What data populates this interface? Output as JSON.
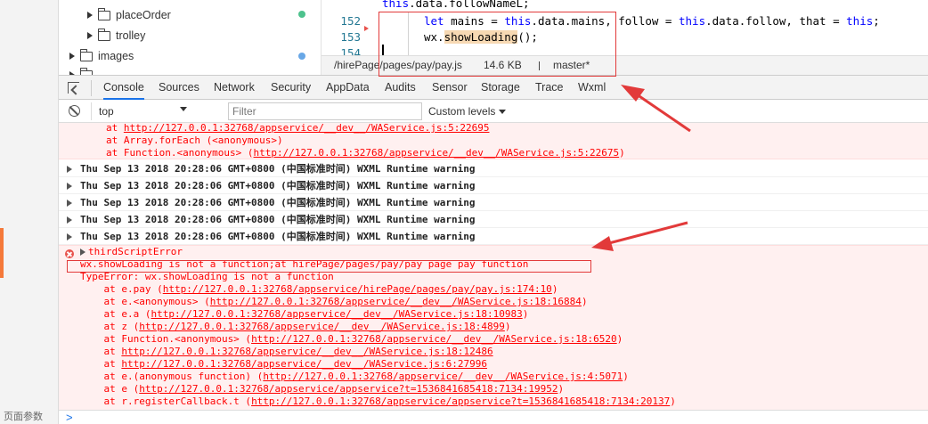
{
  "sidebar_bottom_label": "页面参数",
  "tree": {
    "items": [
      {
        "label": "placeOrder",
        "dot_color": "#4dc28d"
      },
      {
        "label": "trolley"
      },
      {
        "label": "images",
        "dot_color": "#68a7e6"
      },
      {
        "label": "..."
      }
    ]
  },
  "editor": {
    "line_partial": "this.data.followNameL;",
    "lines": [
      {
        "number": "152",
        "code": "let mains = this.data.mains, follow = this.data.follow, that = this;"
      },
      {
        "number": "153",
        "code_prefix": "wx.",
        "code_highlight": "showLoading",
        "code_suffix": "();"
      },
      {
        "number": "154"
      }
    ]
  },
  "statusbar": {
    "path": "/hirePage/pages/pay/pay.js",
    "size": "14.6 KB",
    "branch_icon": "git-branch-icon",
    "branch": "master*"
  },
  "tabs": [
    "Console",
    "Sources",
    "Network",
    "Security",
    "AppData",
    "Audits",
    "Sensor",
    "Storage",
    "Trace",
    "Wxml"
  ],
  "active_tab": "Console",
  "toolbar": {
    "context": "top",
    "filter_placeholder": "Filter",
    "levels": "Custom levels"
  },
  "console": {
    "top_error_lines": [
      {
        "prefix": "        at Array.forEach (<anonymous>)",
        "link": ""
      },
      {
        "prefix": "        at Function.<anonymous> (",
        "link": "http://127.0.0.1:32768/appservice/__dev__/WAService.js:5:22675",
        "suffix": ")"
      }
    ],
    "top_error_first": {
      "prefix": "        at ",
      "link": "http://127.0.0.1:32768/appservice/__dev__/WAService.js:5:22695"
    },
    "warnings": [
      "Thu Sep 13 2018 20:28:06 GMT+0800 (中国标准时间) WXML Runtime warning",
      "Thu Sep 13 2018 20:28:06 GMT+0800 (中国标准时间) WXML Runtime warning",
      "Thu Sep 13 2018 20:28:06 GMT+0800 (中国标准时间) WXML Runtime warning",
      "Thu Sep 13 2018 20:28:06 GMT+0800 (中国标准时间) WXML Runtime warning",
      "Thu Sep 13 2018 20:28:06 GMT+0800 (中国标准时间) WXML Runtime warning"
    ],
    "error_group": "thirdScriptError",
    "error_message": "wx.showLoading is not a function;at hirePage/pages/pay/pay page pay function",
    "type_error": "TypeError: wx.showLoading is not a function",
    "stack": [
      {
        "prefix": "    at e.pay (",
        "link": "http://127.0.0.1:32768/appservice/hirePage/pages/pay/pay.js:174:10",
        "suffix": ")"
      },
      {
        "prefix": "    at e.<anonymous> (",
        "link": "http://127.0.0.1:32768/appservice/__dev__/WAService.js:18:16884",
        "suffix": ")"
      },
      {
        "prefix": "    at e.a (",
        "link": "http://127.0.0.1:32768/appservice/__dev__/WAService.js:18:10983",
        "suffix": ")"
      },
      {
        "prefix": "    at z (",
        "link": "http://127.0.0.1:32768/appservice/__dev__/WAService.js:18:4899",
        "suffix": ")"
      },
      {
        "prefix": "    at Function.<anonymous> (",
        "link": "http://127.0.0.1:32768/appservice/__dev__/WAService.js:18:6520",
        "suffix": ")"
      },
      {
        "prefix": "    at ",
        "link": "http://127.0.0.1:32768/appservice/__dev__/WAService.js:18:12486",
        "suffix": ""
      },
      {
        "prefix": "    at ",
        "link": "http://127.0.0.1:32768/appservice/__dev__/WAService.js:6:27996",
        "suffix": ""
      },
      {
        "prefix": "    at e.(anonymous function) (",
        "link": "http://127.0.0.1:32768/appservice/__dev__/WAService.js:4:5071",
        "suffix": ")"
      },
      {
        "prefix": "    at e (",
        "link": "http://127.0.0.1:32768/appservice/appservice?t=1536841685418:7134:19952",
        "suffix": ")"
      },
      {
        "prefix": "    at r.registerCallback.t (",
        "link": "http://127.0.0.1:32768/appservice/appservice?t=1536841685418:7134:20137",
        "suffix": ")"
      }
    ]
  },
  "prompt_symbol": ">",
  "colors": {
    "error_text": "#ff0000",
    "error_bg": "#fff0f0",
    "annotation": "#e23a3a",
    "active_tab": "#1a73e8",
    "keyword": "#0000ff"
  }
}
